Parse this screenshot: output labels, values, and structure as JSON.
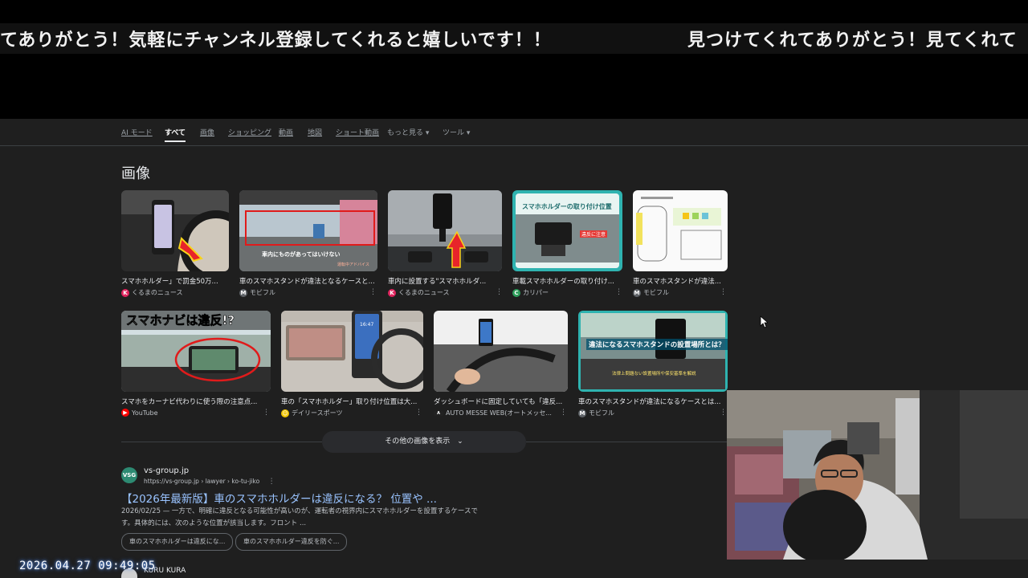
{
  "ticker": {
    "text_left": "てありがとう！気軽にチャンネル登録してくれると嬉しいです！！",
    "text_right": "見つけてくれてありがとう！見てくれて"
  },
  "tabs": [
    {
      "label": "AI モード"
    },
    {
      "label": "すべて"
    },
    {
      "label": "画像"
    },
    {
      "label": "ショッピング"
    },
    {
      "label": "動画"
    },
    {
      "label": "地図"
    },
    {
      "label": "ショート動画"
    },
    {
      "label": "もっと見る ▾"
    },
    {
      "label": "ツール ▾"
    }
  ],
  "images_section": {
    "title": "画像",
    "row1": [
      {
        "caption": "スマホホルダー」で罰金50万...",
        "source": "くるまのニュース",
        "source_color": "#e0245e"
      },
      {
        "caption": "車のスマホスタンドが違法となるケースと...",
        "source": "モビフル",
        "source_color": "#5f6368"
      },
      {
        "caption": "車内に設置する\"スマホホルダ...",
        "source": "くるまのニュース",
        "source_color": "#e0245e"
      },
      {
        "caption": "車載スマホホルダーの取り付け...",
        "source": "カリパー",
        "source_color": "#2e9e5b"
      },
      {
        "caption": "車のスマホスタンドが違法...",
        "source": "モビフル",
        "source_color": "#5f6368"
      }
    ],
    "row2": [
      {
        "caption": "スマホをカーナビ代わりに使う際の注意点...",
        "source": "YouTube",
        "source_color": "#ff0000"
      },
      {
        "caption": "車の「スマホホルダー」取り付け位置は大...",
        "source": "デイリースポーツ",
        "source_color": "#f2c500"
      },
      {
        "caption": "ダッシュボードに固定していても「違反...",
        "source": "AUTO MESSE WEB(オートメッセ...",
        "source_color": "#222222"
      },
      {
        "caption": "車のスマホスタンドが違法になるケースとは...",
        "source": "モビフル",
        "source_color": "#5f6368"
      }
    ],
    "thumb_texts": {
      "t2_overlay": "車内にものがあってはいけない",
      "t2_small": "運転中アドバイス",
      "t4_banner": "スマホホルダーの取り付け位置",
      "t4_tag": "違反に注意",
      "t6_banner": "スマホナビは違反!?",
      "t9_banner": "違法になるスマホスタンドの設置場所とは？",
      "t9_sub": "法律上問題ない設置場所や保安基準を解説",
      "t7_screen": "16:47"
    },
    "more_button": "その他の画像を表示"
  },
  "result": {
    "favicon": "VSG",
    "site_name": "vs-group.jp",
    "url": "https://vs-group.jp › lawyer › ko-tu-jiko",
    "title": "【2026年最新版】車のスマホホルダーは違反になる？ 位置や ...",
    "snippet": "2026/02/25 — 一方で、明確に違反となる可能性が高いのが、運転者の視界内にスマホホルダーを設置するケースです。具体的には、次のような位置が該当します。フロント ...",
    "chips": [
      "車のスマホホルダーは違反にな...",
      "車のスマホホルダー違反を防ぐ..."
    ]
  },
  "next_result": {
    "site_name": "KURU KURA"
  },
  "overlay": {
    "timestamp": "2026.04.27 09:49:05"
  },
  "colors": {
    "page_bg": "#1f1f1f",
    "link": "#99c3ff",
    "text": "#e8eaed",
    "muted": "#bdc1c6"
  }
}
